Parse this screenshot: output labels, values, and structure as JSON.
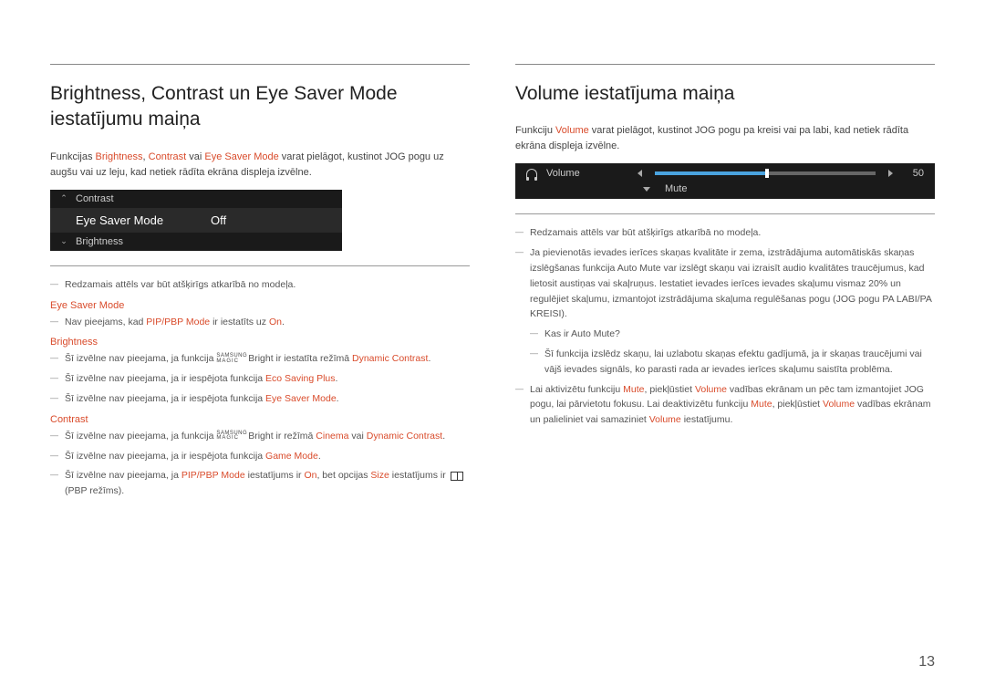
{
  "page_number": "13",
  "left": {
    "heading": "Brightness, Contrast un Eye Saver Mode iestatījumu maiņa",
    "intro_before": "Funkcijas ",
    "intro_hl1": "Brightness",
    "intro_sep1": ", ",
    "intro_hl2": "Contrast",
    "intro_sep2": " vai ",
    "intro_hl3": "Eye Saver Mode",
    "intro_after": " varat pielāgot, kustinot JOG pogu uz augšu vai uz leju, kad netiek rādīta ekrāna displeja izvēlne.",
    "osd": {
      "top_label": "Contrast",
      "main_label": "Eye Saver Mode",
      "main_value": "Off",
      "bottom_label": "Brightness"
    },
    "note_model": "Redzamais attēls var būt atšķirīgs atkarībā no modeļa.",
    "sub1": "Eye Saver Mode",
    "n1_before": "Nav pieejams, kad ",
    "n1_hl": "PIP/PBP Mode",
    "n1_mid": " ir iestatīts uz ",
    "n1_hl2": "On",
    "n1_after": ".",
    "sub2": "Brightness",
    "n2_before": "Šī izvēlne nav pieejama, ja funkcija ",
    "n2_bright": "Bright",
    "n2_mid": " ir iestatīta režīmā ",
    "n2_hl": "Dynamic Contrast",
    "n2_after": ".",
    "n3_before": "Šī izvēlne nav pieejama, ja ir iespējota funkcija ",
    "n3_hl": "Eco Saving Plus",
    "n3_after": ".",
    "n4_before": "Šī izvēlne nav pieejama, ja ir iespējota funkcija ",
    "n4_hl": "Eye Saver Mode",
    "n4_after": ".",
    "sub3": "Contrast",
    "n5_before": "Šī izvēlne nav pieejama, ja funkcija ",
    "n5_bright": "Bright",
    "n5_mid": " ir režīmā ",
    "n5_hl1": "Cinema",
    "n5_mid2": " vai ",
    "n5_hl2": "Dynamic Contrast",
    "n5_after": ".",
    "n6_before": "Šī izvēlne nav pieejama, ja ir iespējota funkcija ",
    "n6_hl": "Game Mode",
    "n6_after": ".",
    "n7_before": "Šī izvēlne nav pieejama, ja ",
    "n7_hl1": "PIP/PBP Mode",
    "n7_mid1": " iestatījums ir ",
    "n7_hl2": "On",
    "n7_mid2": ", bet opcijas ",
    "n7_hl3": "Size",
    "n7_mid3": " iestatījums ir ",
    "n7_after": " (PBP režīms).",
    "magic_top": "SAMSUNG",
    "magic_bot": "MAGIC"
  },
  "right": {
    "heading": "Volume iestatījuma maiņa",
    "intro_before": "Funkciju ",
    "intro_hl": "Volume",
    "intro_after": " varat pielāgot, kustinot JOG pogu pa kreisi vai pa labi, kad netiek rādīta ekrāna displeja izvēlne.",
    "osd": {
      "volume_label": "Volume",
      "volume_value": "50",
      "mute_label": "Mute"
    },
    "note_model": "Redzamais attēls var būt atšķirīgs atkarībā no modeļa.",
    "n1": "Ja pievienotās ievades ierīces skaņas kvalitāte ir zema, izstrādājuma automātiskās skaņas izslēgšanas funkcija Auto Mute var izslēgt skaņu vai izraisīt audio kvalitātes traucējumus, kad lietosit austiņas vai skaļruņus. Iestatiet ievades ierīces ievades skaļumu vismaz 20% un regulējiet skaļumu, izmantojot izstrādājuma skaļuma regulēšanas pogu (JOG pogu PA LABI/PA KREISI).",
    "n1a": "Kas ir Auto Mute?",
    "n1b": "Šī funkcija izslēdz skaņu, lai uzlabotu skaņas efektu gadījumā, ja ir skaņas traucējumi vai vājš ievades signāls, ko parasti rada ar ievades ierīces skaļumu saistīta problēma.",
    "n2_before": "Lai aktivizētu funkciju ",
    "n2_hl1": "Mute",
    "n2_mid1": ", piekļūstiet ",
    "n2_hl2": "Volume",
    "n2_mid2": " vadības ekrānam un pēc tam izmantojiet JOG pogu, lai pārvietotu fokusu. Lai deaktivizētu funkciju ",
    "n2_hl3": "Mute",
    "n2_mid3": ", piekļūstiet ",
    "n2_hl4": "Volume",
    "n2_mid4": " vadības ekrānam un palieliniet vai samaziniet ",
    "n2_hl5": "Volume",
    "n2_after": " iestatījumu."
  }
}
